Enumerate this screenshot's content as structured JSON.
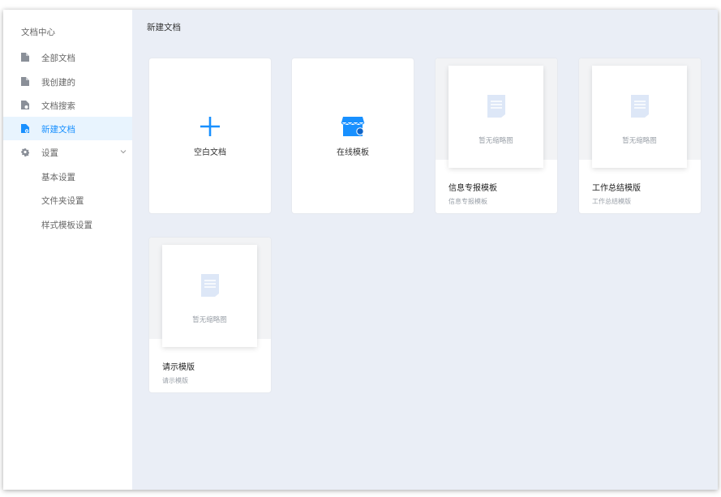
{
  "app_title": "文档中心",
  "sidebar": {
    "items": [
      {
        "label": "全部文档",
        "icon": "document-icon"
      },
      {
        "label": "我创建的",
        "icon": "document-icon"
      },
      {
        "label": "文档搜索",
        "icon": "document-search-icon"
      },
      {
        "label": "新建文档",
        "icon": "document-add-icon",
        "active": true
      },
      {
        "label": "设置",
        "icon": "gear-icon"
      }
    ],
    "settings_sub": [
      "基本设置",
      "文件夹设置",
      "样式模板设置"
    ]
  },
  "main": {
    "title": "新建文档",
    "create_cards": [
      {
        "label": "空白文档",
        "icon": "plus-icon"
      },
      {
        "label": "在线模板",
        "icon": "store-icon"
      }
    ],
    "no_thumbnail_text": "暂无缩略图",
    "templates": [
      {
        "name": "信息专报模板",
        "desc": "信息专报模板"
      },
      {
        "name": "工作总结模版",
        "desc": "工作总结模版"
      },
      {
        "name": "请示模版",
        "desc": "请示模版"
      }
    ]
  },
  "colors": {
    "accent": "#1890ff",
    "main_bg": "#eaeef6",
    "active_item_bg": "#e8f4fe",
    "icon_gray": "#8a8f98"
  }
}
